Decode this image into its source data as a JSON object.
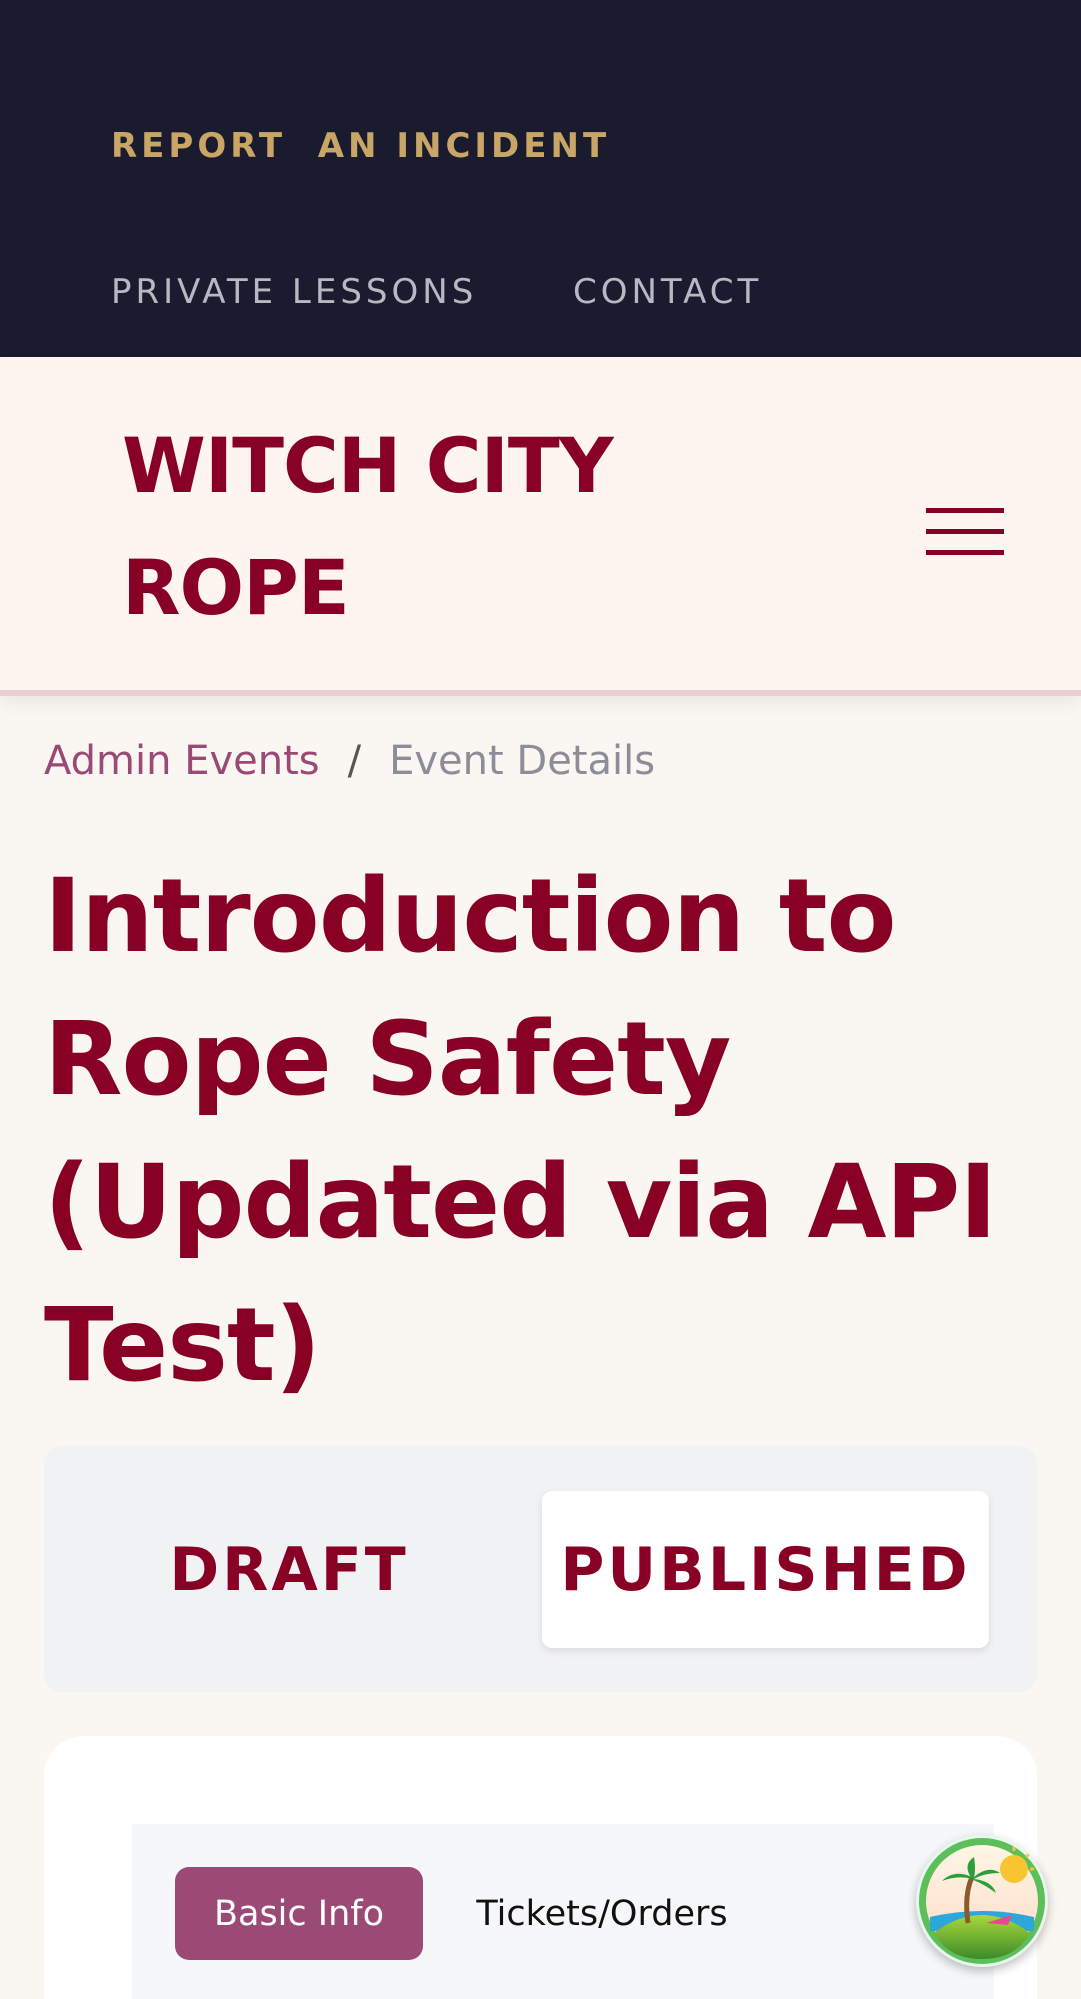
{
  "utility_nav": {
    "report_label": "REPORT  AN INCIDENT",
    "links": [
      "PRIVATE LESSONS",
      "CONTACT"
    ]
  },
  "header": {
    "brand": "WITCH CITY ROPE",
    "menu_icon": "hamburger-menu-icon"
  },
  "breadcrumb": {
    "parent": "Admin Events",
    "separator": "/",
    "current": "Event Details"
  },
  "page": {
    "title": "Introduction to Rope Safety (Updated via API Test)"
  },
  "status_toggle": {
    "options": [
      "DRAFT",
      "PUBLISHED"
    ],
    "selected": "PUBLISHED"
  },
  "tabs": {
    "items": [
      "Basic Info",
      "Tickets/Orders"
    ],
    "active": "Basic Info"
  },
  "helper": {
    "icon": "island-avatar-icon"
  },
  "colors": {
    "primary": "#880124",
    "accent": "#9b4a76",
    "gold": "#c9a566",
    "dark": "#1b1b2f",
    "cream": "#fff5ef"
  }
}
